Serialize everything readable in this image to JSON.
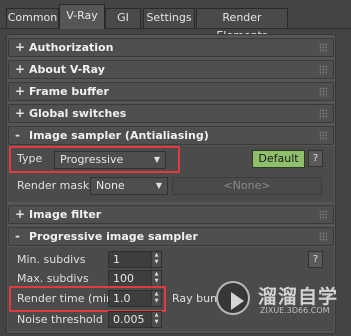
{
  "tabs": [
    {
      "label": "Common"
    },
    {
      "label": "V-Ray"
    },
    {
      "label": "GI"
    },
    {
      "label": "Settings"
    },
    {
      "label": "Render Elements"
    }
  ],
  "rollouts": {
    "authorization": {
      "sign": "+",
      "title": "Authorization"
    },
    "about": {
      "sign": "+",
      "title": "About V-Ray"
    },
    "frame_buffer": {
      "sign": "+",
      "title": "Frame buffer"
    },
    "global_switches": {
      "sign": "+",
      "title": "Global switches"
    },
    "image_sampler": {
      "sign": "-",
      "title": "Image sampler (Antialiasing)"
    },
    "image_filter": {
      "sign": "+",
      "title": "Image filter"
    },
    "progressive": {
      "sign": "-",
      "title": "Progressive image sampler"
    }
  },
  "image_sampler": {
    "type_label": "Type",
    "type_value": "Progressive",
    "default_button": "Default",
    "help_button": "?",
    "render_mask_label": "Render mask",
    "render_mask_value": "None",
    "render_mask_object": "<None>"
  },
  "progressive": {
    "min_subdivs_label": "Min. subdivs",
    "min_subdivs_value": "1",
    "help_button": "?",
    "max_subdivs_label": "Max. subdivs",
    "max_subdivs_value": "100",
    "render_time_label": "Render time (min)",
    "render_time_value": "1.0",
    "ray_bundle_label": "Ray bun",
    "noise_threshold_label": "Noise threshold",
    "noise_threshold_value": "0.005"
  },
  "watermark": {
    "title": "溜溜自学",
    "subtitle": "ZIXUE.3D66.COM"
  },
  "colors": {
    "highlight": "#e23b3b",
    "default_button": "#8fbf6a",
    "panel": "#555555"
  }
}
